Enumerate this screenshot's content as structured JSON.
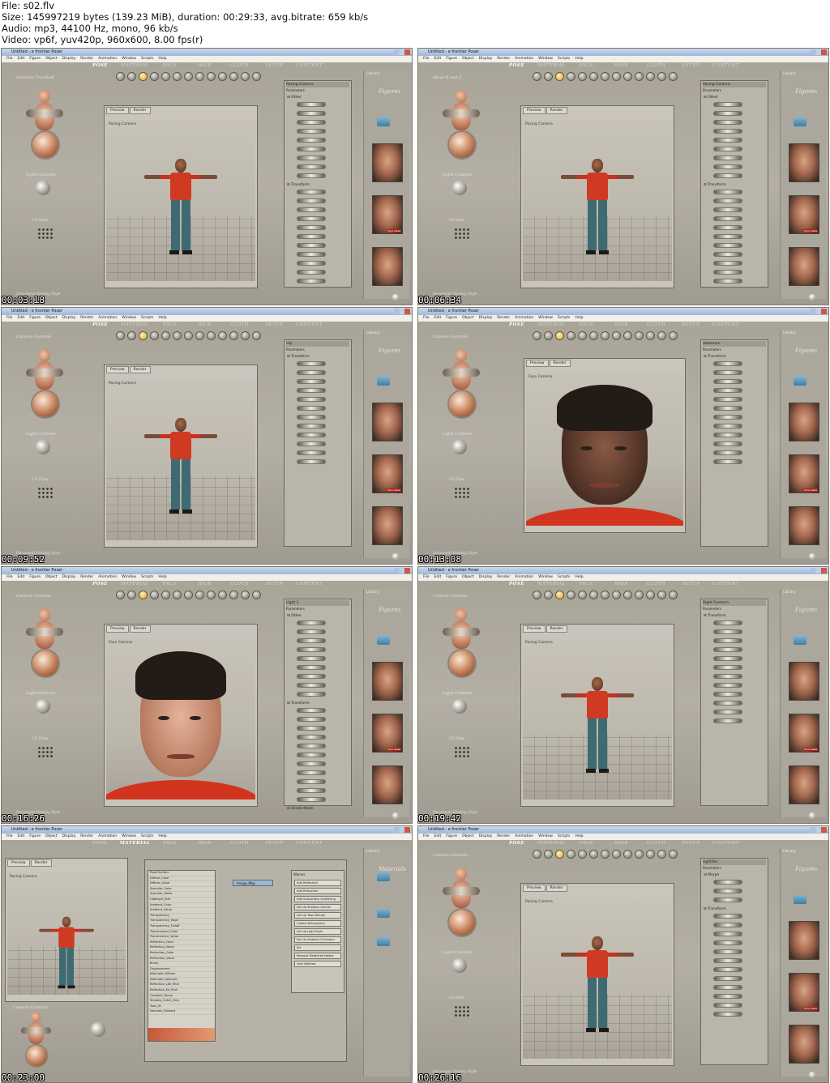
{
  "header": {
    "file": "File: s02.flv",
    "size": "Size: 145997219 bytes (139.23 MiB), duration: 00:29:33, avg.bitrate: 659 kb/s",
    "audio": "Audio: mp3, 44100 Hz, mono, 96 kb/s",
    "video": "Video: vp6f, yuv420p, 960x600,  8.00 fps(r)"
  },
  "app": {
    "window_title": "Untitled - e frontier Poser",
    "menu": [
      "File",
      "Edit",
      "Figure",
      "Object",
      "Display",
      "Render",
      "Animation",
      "Window",
      "Scripts",
      "Help"
    ],
    "rooms": [
      "POSE",
      "MATERIAL",
      "FACE",
      "HAIR",
      "CLOTH",
      "SETUP",
      "CONTENT"
    ],
    "library_label": "Library",
    "figures_title": "Figures",
    "materials_title": "Materials",
    "preview_tab": "Preview",
    "render_tab": "Render",
    "camera_label": "Posing Camera",
    "face_camera_label": "Face Camera",
    "light_controls": "Light Controls",
    "ui_dots": "UI Dots",
    "document_display": "Document Display Style",
    "faces_tag": "Face Ideas",
    "sections": {
      "other": "Other",
      "transform": "Transform",
      "morph": "Morph",
      "shader": "ShaderNode"
    }
  },
  "tiles": [
    {
      "timestamp": "00:03:18",
      "panel_label": "Rotation Trackball",
      "params_title": "Posing Camera",
      "view": "body",
      "room": "POSE"
    },
    {
      "timestamp": "00:06:34",
      "panel_label": "Move X and Z",
      "params_title": "Posing Camera",
      "view": "body",
      "room": "POSE"
    },
    {
      "timestamp": "00:09:52",
      "panel_label": "Camera Controls",
      "params_title": "Hip",
      "view": "body",
      "room": "POSE"
    },
    {
      "timestamp": "00:13:08",
      "panel_label": "Camera Controls",
      "params_title": "Abdomen",
      "view": "face",
      "room": "POSE"
    },
    {
      "timestamp": "00:16:26",
      "panel_label": "Camera Controls",
      "params_title": "Light 1",
      "view": "face2",
      "room": "POSE"
    },
    {
      "timestamp": "00:19:42",
      "panel_label": "Camera Controls",
      "params_title": "Right Forearm",
      "view": "body",
      "room": "POSE"
    },
    {
      "timestamp": "00:23:00",
      "panel_label": "Camera Controls",
      "params_title": "Image_Map",
      "view": "material",
      "room": "MATERIAL"
    },
    {
      "timestamp": "00:26:16",
      "panel_label": "Camera Controls",
      "params_title": "rightToe",
      "view": "body",
      "room": "POSE"
    }
  ],
  "material": {
    "node_rows": [
      "PoserSurface",
      "Diffuse_Color",
      "Diffuse_Value",
      "Specular_Color",
      "Specular_Value",
      "Highlight_Size",
      "Ambient_Color",
      "Ambient_Value",
      "Transparency",
      "Transparency_Edge",
      "Transparency_Falloff",
      "Translucence_Color",
      "Translucence_Value",
      "Reflection_Color",
      "Reflection_Value",
      "Refraction_Color",
      "Refraction_Value",
      "Bump",
      "Displacement",
      "Alternate_Diffuse",
      "Alternate_Specular",
      "Reflection_Lite_Mult",
      "Reflection_Kd_Mult",
      "Gradient_Bump",
      "Shadow_Catch_Only",
      "Toon_ID",
      "Normals_Forward"
    ],
    "image_map": "Image_Map",
    "wizard_title": "Wacros",
    "wizard_buttons": [
      "Add Reflection",
      "Add Refraction",
      "Add Subsurface Scattering",
      "Set Up Shadow Catcher",
      "Set Up Toon Render",
      "Create Atmosphere",
      "Set Up Light Style",
      "Set Up Ambient Occlusion",
      "IDL",
      "Remove Detached Nodes",
      "User Defined"
    ]
  }
}
